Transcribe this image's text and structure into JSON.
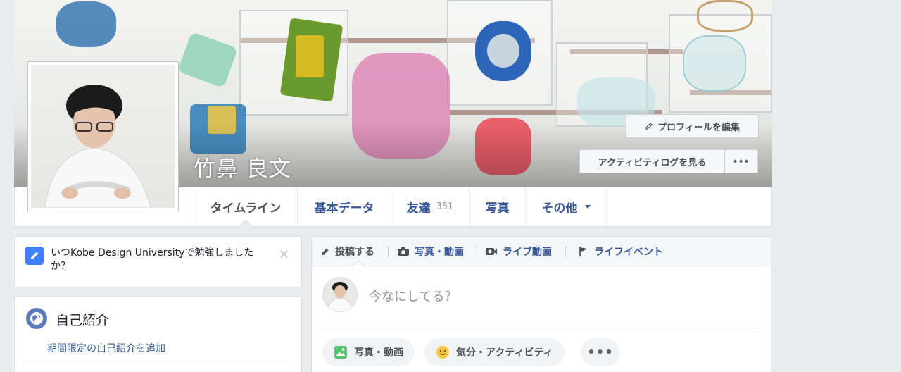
{
  "profile": {
    "name": "竹鼻 良文",
    "edit_profile_label": "プロフィールを編集",
    "activity_log_label": "アクティビティログを見る",
    "more_label": "•••"
  },
  "tabs": [
    {
      "label": "タイムライン"
    },
    {
      "label": "基本データ"
    },
    {
      "label": "友達",
      "count": "351"
    },
    {
      "label": "写真"
    },
    {
      "label": "その他"
    }
  ],
  "sidebar": {
    "prompt": {
      "text": "いつKobe Design Universityで勉強しましたか？",
      "close": "✕"
    },
    "intro": {
      "title": "自己紹介",
      "link": "期間限定の自己紹介を追加"
    }
  },
  "composer": {
    "tabs": [
      {
        "label": "投稿する",
        "icon": "pencil-icon"
      },
      {
        "label": "写真・動画",
        "icon": "camera-icon"
      },
      {
        "label": "ライブ動画",
        "icon": "video-camera-icon"
      },
      {
        "label": "ライフイベント",
        "icon": "flag-icon"
      }
    ],
    "placeholder": "今なにしてる？",
    "actions": [
      {
        "label": "写真・動画",
        "icon": "photo-icon"
      },
      {
        "label": "気分・アクティビティ",
        "icon": "smiley-icon"
      },
      {
        "label": "•••",
        "icon": "more-icon"
      }
    ]
  },
  "colors": {
    "link": "#365899",
    "background": "#e9ebee",
    "accent": "#4080ff"
  }
}
